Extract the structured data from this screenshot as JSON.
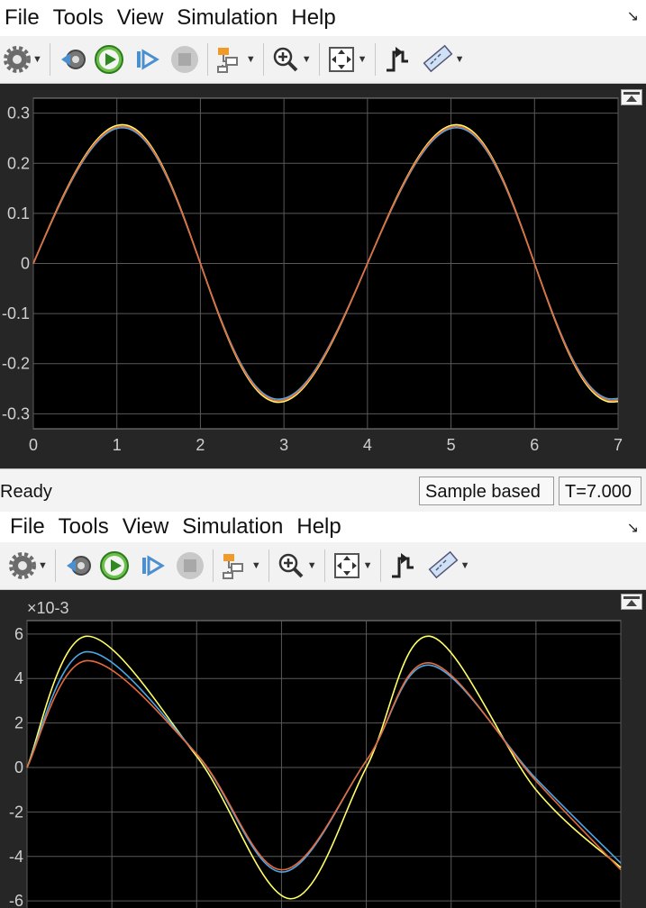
{
  "menu": [
    "File",
    "Tools",
    "View",
    "Simulation",
    "Help"
  ],
  "toolbar_icons": [
    "configuration-properties-icon",
    "step-back-icon",
    "run-icon",
    "step-forward-icon",
    "stop-icon",
    "signal-selector-icon",
    "zoom-in-icon",
    "fit-to-view-icon",
    "triggers-icon",
    "cursor-measurements-icon"
  ],
  "status": {
    "ready": "Ready",
    "mode": "Sample based",
    "time": "T=7.000"
  },
  "colors": {
    "plot_bg": "#000000",
    "panel_bg": "#262626",
    "grid": "#5a5a5a",
    "series_yellow": "#ffff66",
    "series_blue": "#4aa8e8",
    "series_orange": "#e86a3a"
  },
  "chart_data": [
    {
      "type": "line",
      "title": "",
      "xlabel": "",
      "ylabel": "",
      "xlim": [
        0,
        7
      ],
      "ylim": [
        -0.33,
        0.33
      ],
      "xticks": [
        "0",
        "1",
        "2",
        "3",
        "4",
        "5",
        "6",
        "7"
      ],
      "yticks": [
        "0.3",
        "0.2",
        "0.1",
        "0",
        "-0.1",
        "-0.2",
        "-0.3"
      ],
      "grid": true,
      "series": [
        {
          "color": "#ffff66",
          "amplitude": 0.277,
          "x": [
            0,
            0.5,
            1.08,
            2.0,
            3.08,
            4.0,
            5.08,
            6.0,
            7.0
          ],
          "y": [
            0,
            0.19,
            0.277,
            0.13,
            -0.277,
            0.0,
            0.277,
            0.07,
            -0.27
          ]
        },
        {
          "color": "#4aa8e8",
          "amplitude": 0.271,
          "x": [
            0,
            0.5,
            1.08,
            2.0,
            3.08,
            4.0,
            5.08,
            6.0,
            7.0
          ],
          "y": [
            0,
            0.18,
            0.271,
            0.13,
            -0.271,
            0.0,
            0.271,
            0.07,
            -0.265
          ]
        },
        {
          "color": "#e86a3a",
          "amplitude": 0.274,
          "x": [
            0,
            0.5,
            1.08,
            2.0,
            3.08,
            4.0,
            5.08,
            6.0,
            7.0
          ],
          "y": [
            0,
            0.185,
            0.274,
            0.13,
            -0.274,
            0.0,
            0.274,
            0.07,
            -0.268
          ]
        }
      ]
    },
    {
      "type": "line",
      "title": "",
      "xlabel": "",
      "ylabel": "",
      "scale_label": "×10-3",
      "xlim": [
        0,
        7
      ],
      "ylim": [
        -6.6,
        6.6
      ],
      "yticks": [
        "6",
        "4",
        "2",
        "0",
        "-2",
        "-4",
        "-6"
      ],
      "grid": true,
      "series": [
        {
          "color": "#ffff66",
          "x": [
            0,
            0.7,
            2.0,
            3.1,
            4.0,
            4.75,
            6.0,
            7.0
          ],
          "y": [
            0,
            5.9,
            0.5,
            -5.9,
            0.0,
            5.9,
            -1.0,
            -4.5
          ]
        },
        {
          "color": "#4aa8e8",
          "x": [
            0,
            0.7,
            2.0,
            3.0,
            4.0,
            4.75,
            6.0,
            7.0
          ],
          "y": [
            0,
            5.2,
            0.6,
            -4.7,
            0.3,
            4.6,
            -0.5,
            -4.3
          ]
        },
        {
          "color": "#e86a3a",
          "x": [
            0,
            0.7,
            2.0,
            3.0,
            4.0,
            4.75,
            6.0,
            7.0
          ],
          "y": [
            0,
            4.8,
            0.6,
            -4.6,
            0.3,
            4.7,
            -0.6,
            -4.6
          ]
        }
      ]
    }
  ]
}
